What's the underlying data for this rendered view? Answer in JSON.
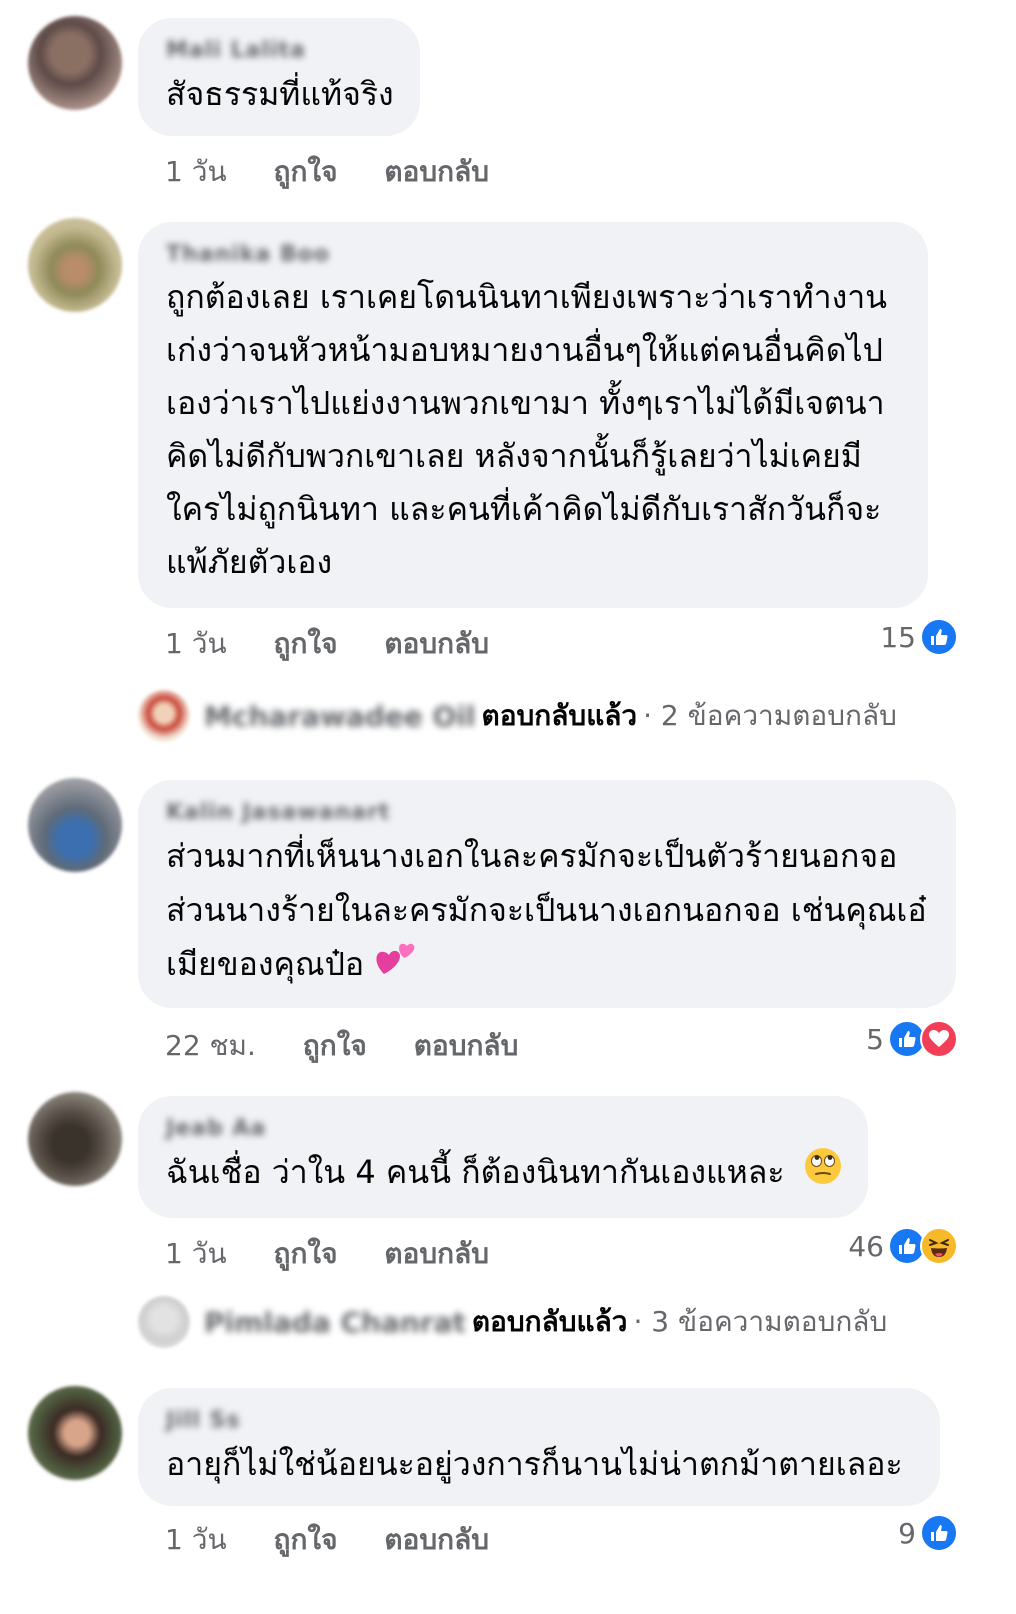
{
  "comments": [
    {
      "author": "Mali Lalita",
      "lines": [
        "สัจธรรมที่แท้จริง"
      ],
      "time": "1 วัน",
      "like_label": "ถูกใจ",
      "reply_label": "ตอบกลับ"
    },
    {
      "author": "Thanika Boo",
      "lines": [
        "ถูกต้องเลย เราเคยโดนนินทาเพียงเพราะว่าเราทำงาน",
        "เก่งว่าจนหัวหน้ามอบหมายงานอื่นๆให้แต่คนอื่นคิดไป",
        "เองว่าเราไปแย่งงานพวกเขามา ทั้งๆเราไม่ได้มีเจตนา",
        "คิดไม่ดีกับพวกเขาเลย หลังจากนั้นก็รู้เลยว่าไม่เคยมี",
        "ใครไม่ถูกนินทา และคนที่เค้าคิดไม่ดีกับเราสักวันก็จะ",
        "แพ้ภัยตัวเอง"
      ],
      "time": "1 วัน",
      "like_label": "ถูกใจ",
      "reply_label": "ตอบกลับ",
      "reaction_count": "15",
      "replies": {
        "name": "Mcharawadee Oil",
        "label": "ตอบกลับแล้ว",
        "count": "· 2 ข้อความตอบกลับ"
      }
    },
    {
      "author": "Kalin Jasawanart",
      "lines": [
        "ส่วนมากที่เห็นนางเอกในละครมักจะเป็นตัวร้ายนอกจอ",
        "ส่วนนางร้ายในละครมักจะเป็นนางเอกนอกจอ เช่นคุณเอ๋",
        "เมียของคุณป๋อ"
      ],
      "time": "22 ชม.",
      "like_label": "ถูกใจ",
      "reply_label": "ตอบกลับ",
      "reaction_count": "5"
    },
    {
      "author": "Jeab Aa",
      "lines": [
        "ฉันเชื่อ ว่าใน 4 คนนี้ ก็ต้องนินทากันเองแหละ"
      ],
      "time": "1 วัน",
      "like_label": "ถูกใจ",
      "reply_label": "ตอบกลับ",
      "reaction_count": "46",
      "replies": {
        "name": "Pimlada Chanrat",
        "label": "ตอบกลับแล้ว",
        "count": "· 3 ข้อความตอบกลับ"
      }
    },
    {
      "author": "Jill Ss",
      "lines": [
        "อายุก็ไม่ใช่น้อยนะอยู่วงการก็นานไม่น่าตกม้าตายเลอะ"
      ],
      "time": "1 วัน",
      "like_label": "ถูกใจ",
      "reply_label": "ตอบกลับ",
      "reaction_count": "9"
    }
  ],
  "colors": {
    "bubble": "#f0f2f5",
    "meta_text": "#65676b",
    "like_blue": "#1877f2",
    "love_red": "#f33e58",
    "haha_yellow": "#f7b928"
  },
  "icons": {
    "like": "thumbs-up-icon",
    "love": "heart-icon",
    "haha": "laughing-face-icon",
    "hearts_emoji": "two-hearts-emoji",
    "eyeroll_emoji": "eye-roll-emoji"
  }
}
